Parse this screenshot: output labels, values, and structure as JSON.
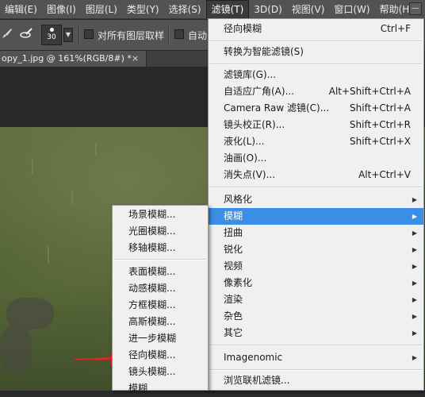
{
  "menubar": {
    "items": [
      "编辑(E)",
      "图像(I)",
      "图层(L)",
      "类型(Y)",
      "选择(S)",
      "滤镜(T)",
      "3D(D)",
      "视图(V)",
      "窗口(W)",
      "帮助(H)"
    ],
    "active_index": 5
  },
  "options_bar": {
    "brush_size": "30",
    "sample_all_layers_label": "对所有图层取样",
    "auto_label": "自动"
  },
  "document_tab": {
    "title": "opy_1.jpg @ 161%(RGB/8#) *",
    "close_glyph": "×"
  },
  "filter_menu": {
    "last_filter": {
      "label": "径向模糊",
      "shortcut": "Ctrl+F"
    },
    "smart_filters": {
      "label": "转换为智能滤镜(S)"
    },
    "gallery": [
      {
        "label": "滤镜库(G)...",
        "shortcut": ""
      },
      {
        "label": "自适应广角(A)...",
        "shortcut": "Alt+Shift+Ctrl+A"
      },
      {
        "label": "Camera Raw 滤镜(C)...",
        "shortcut": "Shift+Ctrl+A"
      },
      {
        "label": "镜头校正(R)...",
        "shortcut": "Shift+Ctrl+R"
      },
      {
        "label": "液化(L)...",
        "shortcut": "Shift+Ctrl+X"
      },
      {
        "label": "油画(O)...",
        "shortcut": ""
      },
      {
        "label": "消失点(V)...",
        "shortcut": "Alt+Ctrl+V"
      }
    ],
    "submenus": [
      "风格化",
      "模糊",
      "扭曲",
      "锐化",
      "视频",
      "像素化",
      "渲染",
      "杂色",
      "其它"
    ],
    "highlighted_submenu": "模糊",
    "plugins": [
      "Imagenomic"
    ],
    "browse_online": "浏览联机滤镜..."
  },
  "blur_menu": {
    "group1": [
      "场景模糊...",
      "光圈模糊...",
      "移轴模糊..."
    ],
    "group2": [
      "表面模糊...",
      "动感模糊...",
      "方框模糊...",
      "高斯模糊...",
      "进一步模糊",
      "径向模糊...",
      "镜头模糊...",
      "模糊"
    ]
  },
  "colors": {
    "menu_bg": "#f0f0f0",
    "highlight": "#3a8ee6",
    "app_chrome": "#535353",
    "arrow": "#e8251f"
  },
  "icons": {
    "brush_tool": "brush-icon",
    "brush_mode": "brush-mode-icon",
    "submenu": "triangle-right-icon"
  }
}
